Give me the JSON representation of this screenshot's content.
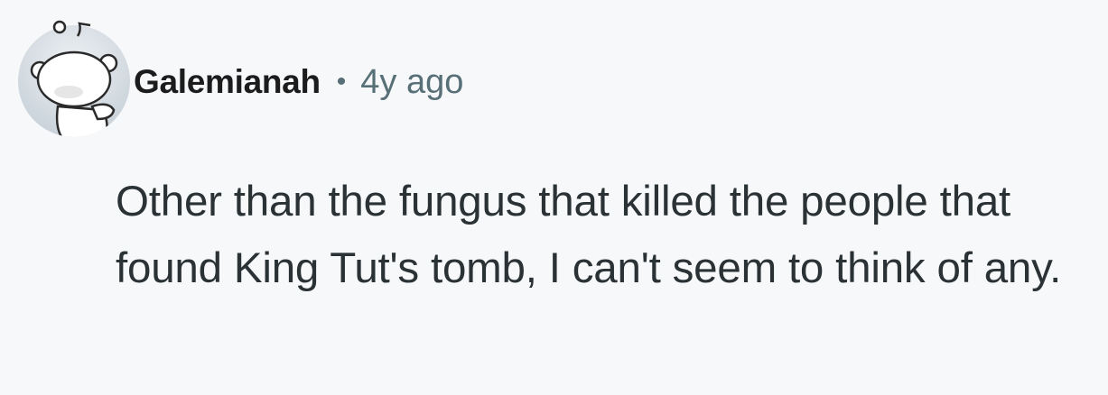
{
  "comment": {
    "author": "Galemianah",
    "separator": "•",
    "timestamp": "4y ago",
    "body": "Other than the fungus that killed the people that found King Tut's tomb, I can't seem to think of any."
  },
  "avatar": {
    "icon": "snoo-avatar-icon",
    "background": "#d6dde3"
  }
}
